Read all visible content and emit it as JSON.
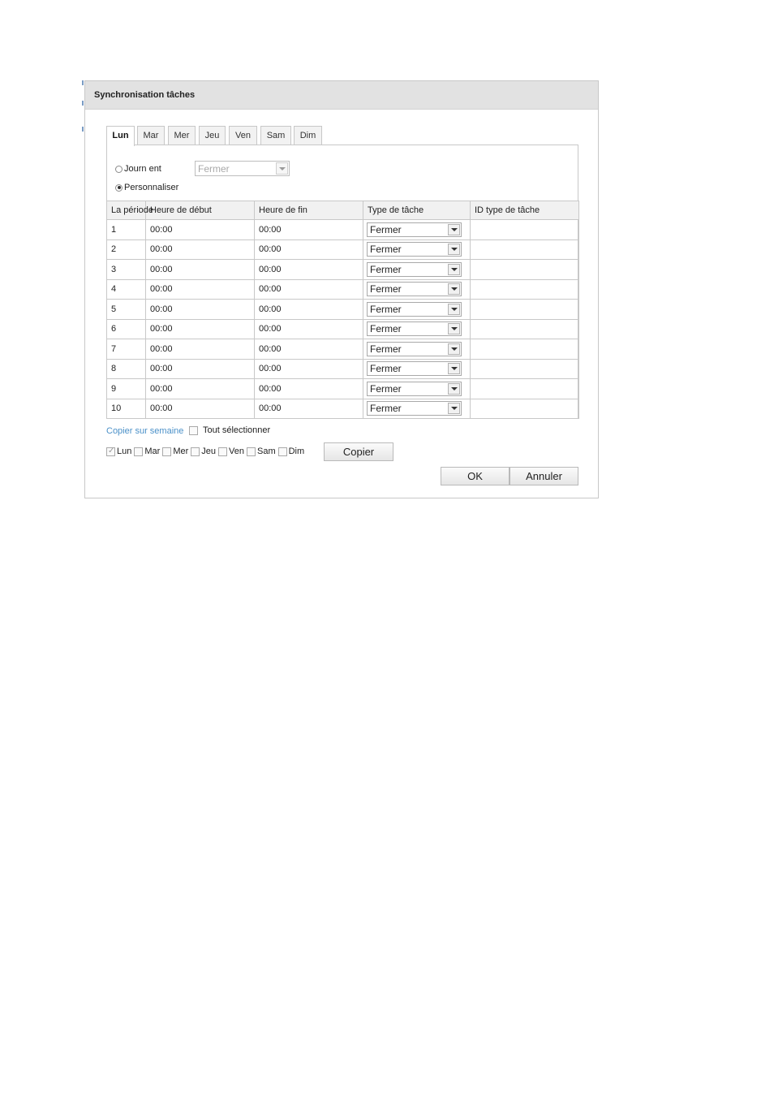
{
  "dialog": {
    "title": "Synchronisation tâches"
  },
  "tabs": [
    {
      "label": "Lun",
      "active": true
    },
    {
      "label": "Mar",
      "active": false
    },
    {
      "label": "Mer",
      "active": false
    },
    {
      "label": "Jeu",
      "active": false
    },
    {
      "label": "Ven",
      "active": false
    },
    {
      "label": "Sam",
      "active": false
    },
    {
      "label": "Dim",
      "active": false
    }
  ],
  "mode": {
    "full_day_label": "Journ ent",
    "full_day_checked": false,
    "full_day_select_value": "Fermer",
    "custom_label": "Personnaliser",
    "custom_checked": true
  },
  "table": {
    "headers": [
      "La période",
      "Heure de début",
      "Heure de fin",
      "Type de tâche",
      "ID type de tâche"
    ],
    "rows": [
      {
        "period": "1",
        "start": "00:00",
        "end": "00:00",
        "type": "Fermer",
        "type_id": ""
      },
      {
        "period": "2",
        "start": "00:00",
        "end": "00:00",
        "type": "Fermer",
        "type_id": ""
      },
      {
        "period": "3",
        "start": "00:00",
        "end": "00:00",
        "type": "Fermer",
        "type_id": ""
      },
      {
        "period": "4",
        "start": "00:00",
        "end": "00:00",
        "type": "Fermer",
        "type_id": ""
      },
      {
        "period": "5",
        "start": "00:00",
        "end": "00:00",
        "type": "Fermer",
        "type_id": ""
      },
      {
        "period": "6",
        "start": "00:00",
        "end": "00:00",
        "type": "Fermer",
        "type_id": ""
      },
      {
        "period": "7",
        "start": "00:00",
        "end": "00:00",
        "type": "Fermer",
        "type_id": ""
      },
      {
        "period": "8",
        "start": "00:00",
        "end": "00:00",
        "type": "Fermer",
        "type_id": ""
      },
      {
        "period": "9",
        "start": "00:00",
        "end": "00:00",
        "type": "Fermer",
        "type_id": ""
      },
      {
        "period": "10",
        "start": "00:00",
        "end": "00:00",
        "type": "Fermer",
        "type_id": ""
      }
    ]
  },
  "copy": {
    "link_label": "Copier sur semaine",
    "select_all_label": "Tout sélectionner",
    "select_all_checked": false,
    "days": [
      {
        "label": "Lun",
        "checked": true
      },
      {
        "label": "Mar",
        "checked": false
      },
      {
        "label": "Mer",
        "checked": false
      },
      {
        "label": "Jeu",
        "checked": false
      },
      {
        "label": "Ven",
        "checked": false
      },
      {
        "label": "Sam",
        "checked": false
      },
      {
        "label": "Dim",
        "checked": false
      }
    ],
    "copy_button_label": "Copier"
  },
  "footer": {
    "ok_label": "OK",
    "cancel_label": "Annuler"
  },
  "colors": {
    "header_bg": "#e2e2e2",
    "border": "#c8c8c8",
    "link": "#4a90c8",
    "panel_bg": "#ffffff"
  },
  "icons": {
    "dropdown": "chevron-down-icon",
    "radio": "radio-icon",
    "checkbox": "checkbox-icon"
  }
}
